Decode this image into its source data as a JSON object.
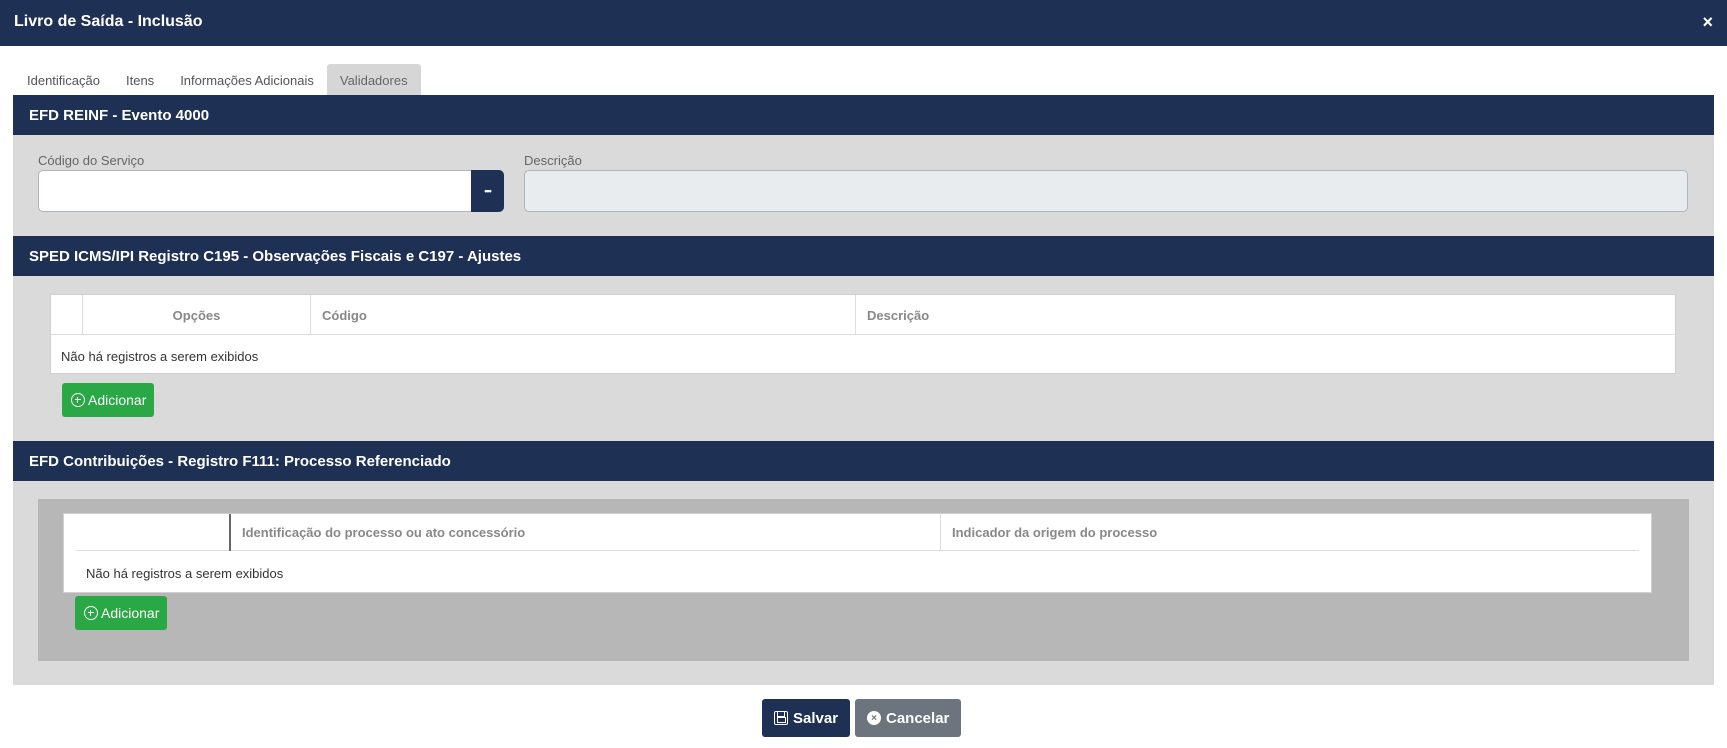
{
  "window": {
    "title": "Livro de Saída - Inclusão",
    "close_glyph": "×"
  },
  "tabs": [
    {
      "label": "Identificação",
      "active": false
    },
    {
      "label": "Itens",
      "active": false
    },
    {
      "label": "Informações Adicionais",
      "active": false
    },
    {
      "label": "Validadores",
      "active": true
    }
  ],
  "sections": {
    "reinf": {
      "title": "EFD REINF - Evento 4000",
      "codigo_label": "Código do Serviço",
      "codigo_value": "",
      "lookup_glyph": "•••",
      "descricao_label": "Descrição",
      "descricao_value": ""
    },
    "sped": {
      "title": "SPED ICMS/IPI Registro C195 - Observações Fiscais e C197 - Ajustes",
      "columns": [
        "",
        "Opções",
        "Código",
        "Descrição"
      ],
      "empty_text": "Não há registros a serem exibidos",
      "add_label": "Adicionar"
    },
    "contrib": {
      "title": "EFD Contribuições - Registro F111: Processo Referenciado",
      "columns": [
        "",
        "Identificação do processo ou ato concessório",
        "Indicador da origem do processo"
      ],
      "empty_text": "Não há registros a serem exibidos",
      "add_label": "Adicionar"
    }
  },
  "footer": {
    "save_label": "Salvar",
    "cancel_label": "Cancelar",
    "cancel_glyph": "×"
  },
  "colors": {
    "header_navy": "#1f3055",
    "panel_gray": "#dadada",
    "add_green": "#29a845",
    "cancel_gray": "#6c757d"
  },
  "icons": [
    "close-icon",
    "ellipsis-icon",
    "plus-circle-icon",
    "floppy-disk-icon",
    "x-circle-icon"
  ]
}
